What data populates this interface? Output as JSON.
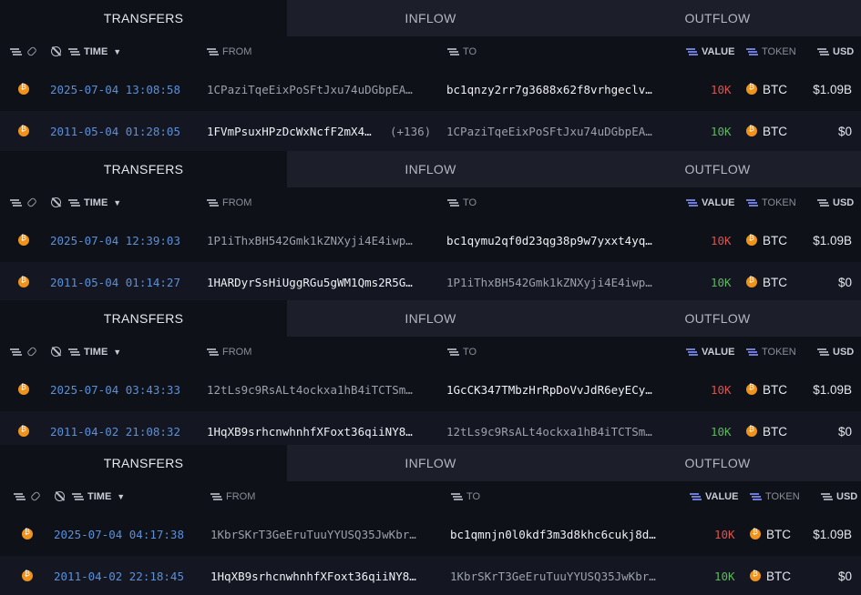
{
  "tabs": [
    "TRANSFERS",
    "INFLOW",
    "OUTFLOW"
  ],
  "headers": {
    "time": "TIME",
    "from": "FROM",
    "to": "TO",
    "value": "VALUE",
    "token": "TOKEN",
    "usd": "USD"
  },
  "icons": {
    "filter": "filter-icon",
    "link": "link-icon",
    "hide": "eye-slash-icon",
    "sort": "caret-down-icon",
    "btc": "bitcoin-icon"
  },
  "colors": {
    "date": "#5b8fd6",
    "outflow_value": "#d9534f",
    "inflow_value": "#5cb85c",
    "btc": "#f0931a",
    "active_tab_bg": "#0f1119",
    "inactive_tab_bg": "#1c1f29"
  },
  "panels": [
    {
      "rows": [
        {
          "time": "2025-07-04 13:08:58",
          "from": "1CPaziTqeEixPoSFtJxu74uDGbpEA…",
          "to": "bc1qnzy2rr7g3688x62f8vrhgeclv…",
          "value": "10K",
          "token": "BTC",
          "usd": "$1.09B"
        },
        {
          "time": "2011-05-04 01:28:05",
          "from": "1FVmPsuxHPzDcWxNcfF2mX4…",
          "from_extra": "(+136)",
          "to": "1CPaziTqeEixPoSFtJxu74uDGbpEA…",
          "value": "10K",
          "token": "BTC",
          "usd": "$0"
        }
      ]
    },
    {
      "rows": [
        {
          "time": "2025-07-04 12:39:03",
          "from": "1P1iThxBH542Gmk1kZNXyji4E4iwp…",
          "to": "bc1qymu2qf0d23qg38p9w7yxxt4yq…",
          "value": "10K",
          "token": "BTC",
          "usd": "$1.09B"
        },
        {
          "time": "2011-05-04 01:14:27",
          "from": "1HARDyrSsHiUggRGu5gWM1Qms2R5G…",
          "to": "1P1iThxBH542Gmk1kZNXyji4E4iwp…",
          "value": "10K",
          "token": "BTC",
          "usd": "$0"
        }
      ]
    },
    {
      "rows": [
        {
          "time": "2025-07-04 03:43:33",
          "from": "12tLs9c9RsALt4ockxa1hB4iTCTSm…",
          "to": "1GcCK347TMbzHrRpDoVvJdR6eyECy…",
          "value": "10K",
          "token": "BTC",
          "usd": "$1.09B"
        },
        {
          "time": "2011-04-02 21:08:32",
          "from": "1HqXB9srhcnwhnhfXFoxt36qiiNY8…",
          "to": "12tLs9c9RsALt4ockxa1hB4iTCTSm…",
          "value": "10K",
          "token": "BTC",
          "usd": "$0"
        }
      ]
    },
    {
      "rows": [
        {
          "time": "2025-07-04 04:17:38",
          "from": "1KbrSKrT3GeEruTuuYYUSQ35JwKbr…",
          "to": "bc1qmnjn0l0kdf3m3d8khc6cukj8d…",
          "value": "10K",
          "token": "BTC",
          "usd": "$1.09B"
        },
        {
          "time": "2011-04-02 22:18:45",
          "from": "1HqXB9srhcnwhnhfXFoxt36qiiNY8…",
          "to": "1KbrSKrT3GeEruTuuYYUSQ35JwKbr…",
          "value": "10K",
          "token": "BTC",
          "usd": "$0"
        }
      ]
    }
  ]
}
